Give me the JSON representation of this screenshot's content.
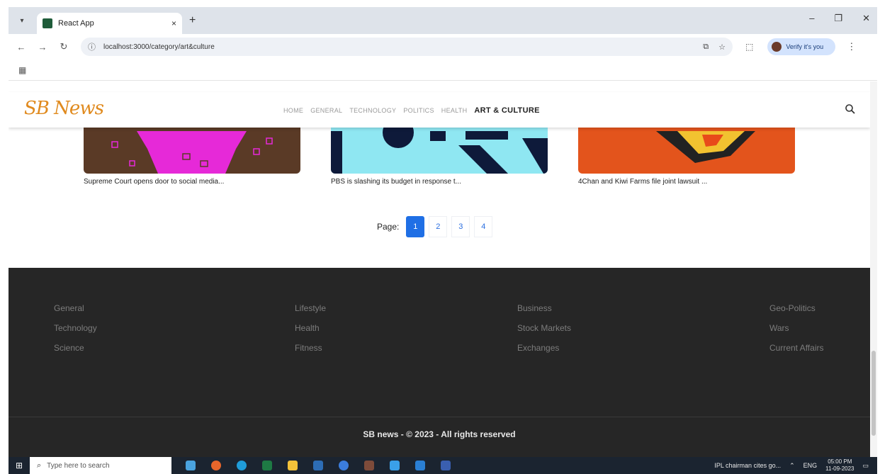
{
  "browser": {
    "tab_title": "React App",
    "tab_close": "×",
    "new_tab": "+",
    "window_controls": [
      "–",
      "❐",
      "✕"
    ],
    "url": "localhost:3000/category/art&culture",
    "profile_label": "Verify it's you"
  },
  "site": {
    "logo": "SB News",
    "nav": [
      "HOME",
      "GENERAL",
      "TECHNOLOGY",
      "POLITICS",
      "HEALTH"
    ],
    "nav_active": "ART & CULTURE"
  },
  "cards": [
    {
      "caption": "Supreme Court opens door to social media..."
    },
    {
      "caption": "PBS is slashing its budget in response t..."
    },
    {
      "caption": "4Chan and Kiwi Farms file joint lawsuit ..."
    }
  ],
  "pagination": {
    "label": "Page:",
    "pages": [
      "1",
      "2",
      "3",
      "4"
    ],
    "current": "1"
  },
  "footer": {
    "columns": [
      [
        "General",
        "Technology",
        "Science"
      ],
      [
        "Lifestyle",
        "Health",
        "Fitness"
      ],
      [
        "Business",
        "Stock Markets",
        "Exchanges"
      ],
      [
        "Geo-Politics",
        "Wars",
        "Current Affairs"
      ]
    ],
    "copyright": "SB news - © 2023 - All rights reserved"
  },
  "taskbar": {
    "search_placeholder": "Type here to search",
    "news_item": "IPL chairman cites go...",
    "language": "ENG",
    "time": "05:00 PM",
    "date": "11-09-2023"
  },
  "colors": {
    "logo": "#e08a1e",
    "accent": "#1f6fe5",
    "footer_bg": "#262626"
  }
}
